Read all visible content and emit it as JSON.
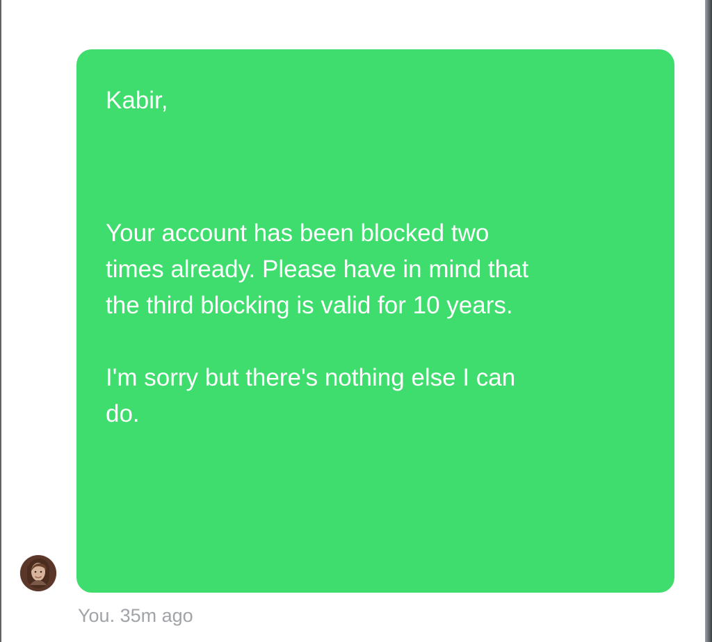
{
  "message": {
    "greeting": "Kabir,",
    "paragraph1": {
      "line1": "Your account has been blocked two",
      "line2": "times already. Please have in mind that",
      "line3": "the third blocking is valid for 10 years."
    },
    "paragraph2": {
      "line1": "I'm sorry but there's nothing else I can",
      "line2": "do."
    },
    "meta": "You. 35m ago"
  },
  "colors": {
    "bubble": "#3fdc6e",
    "text": "#ffffff",
    "meta": "#a0a3a8"
  },
  "icons": {
    "avatar": "profile-avatar"
  }
}
